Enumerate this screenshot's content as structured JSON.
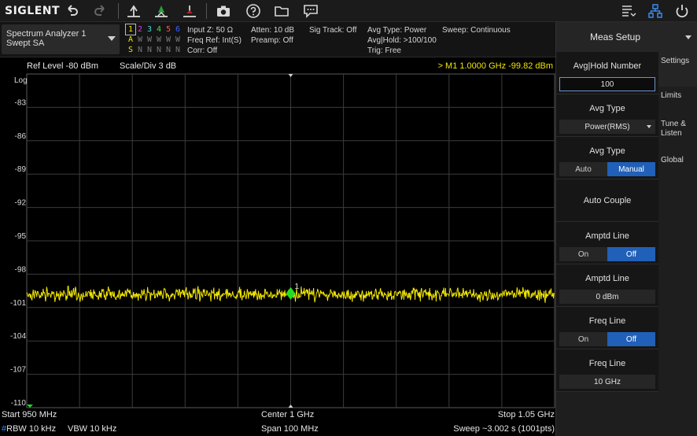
{
  "toolbar": {
    "brand": "SIGLENT",
    "icons": [
      "undo-icon",
      "redo-icon",
      "peak-marker-icon",
      "marker-to-center-icon",
      "marker-delta-icon",
      "camera-icon",
      "help-icon",
      "folder-icon",
      "message-icon",
      "list-icon",
      "network-icon",
      "power-icon"
    ]
  },
  "mode": {
    "line1": "Spectrum Analyzer 1",
    "line2": "Swept SA"
  },
  "traces": {
    "numbers": [
      "1",
      "2",
      "3",
      "4",
      "5",
      "6"
    ],
    "number_colors": [
      "#f2e600",
      "#d040d8",
      "#40d8e0",
      "#40e040",
      "#ff5050",
      "#4060ff"
    ],
    "types": [
      "A",
      "W",
      "W",
      "W",
      "W",
      "W"
    ],
    "detectors": [
      "S",
      "N",
      "N",
      "N",
      "N",
      "N"
    ]
  },
  "info": {
    "input": {
      "line1": "Input Z: 50 Ω",
      "line2": "Freq Ref: Int(S)",
      "line3": "Corr: Off"
    },
    "atten": {
      "line1": "Atten: 10 dB",
      "line2": "Preamp: Off"
    },
    "sig_track": {
      "line1": "Sig Track: Off"
    },
    "avg": {
      "line1": "Avg Type: Power",
      "line2": "Avg|Hold: >100/100",
      "line3": "Trig: Free"
    },
    "sweep": {
      "line1": "Sweep: Continuous"
    }
  },
  "plot": {
    "ref_level": "Ref Level  -80 dBm",
    "scale_div": "Scale/Div  3 dB",
    "marker_readout": ">  M1    1.0000 GHz   -99.82 dBm",
    "log_label": "Log",
    "y_ticks": [
      "-83",
      "-86",
      "-89",
      "-92",
      "-95",
      "-98",
      "-101",
      "-104",
      "-107",
      "-110"
    ],
    "marker_label": "1",
    "trace_level_dbm": -99.8,
    "trace_color": "#f2e600",
    "marker_color": "#22dd22"
  },
  "footer": {
    "start": "Start  950 MHz",
    "center": "Center  1 GHz",
    "stop": "Stop  1.05 GHz",
    "rbw_prefix": "#",
    "rbw": "RBW  10 kHz",
    "vbw": "VBW  10 kHz",
    "span": "Span  100 MHz",
    "sweep": "Sweep  ~3.002 s (1001pts)"
  },
  "panel": {
    "title": "Meas Setup",
    "avg_hold_label": "Avg|Hold Number",
    "avg_hold_value": "100",
    "avg_type_label": "Avg Type",
    "avg_type_value": "Power(RMS)",
    "avg_type2_label": "Avg Type",
    "avg_type2_options": [
      "Auto",
      "Manual"
    ],
    "auto_couple_label": "Auto Couple",
    "amptd_line_label": "Amptd Line",
    "amptd_line_options": [
      "On",
      "Off"
    ],
    "amptd_line_value_label": "Amptd Line",
    "amptd_line_value": "0 dBm",
    "freq_line_label": "Freq Line",
    "freq_line_options": [
      "On",
      "Off"
    ],
    "freq_line_value_label": "Freq Line",
    "freq_line_value": "10 GHz",
    "side_tabs": [
      "Settings",
      "Limits",
      "Tune & Listen",
      "Global"
    ]
  }
}
